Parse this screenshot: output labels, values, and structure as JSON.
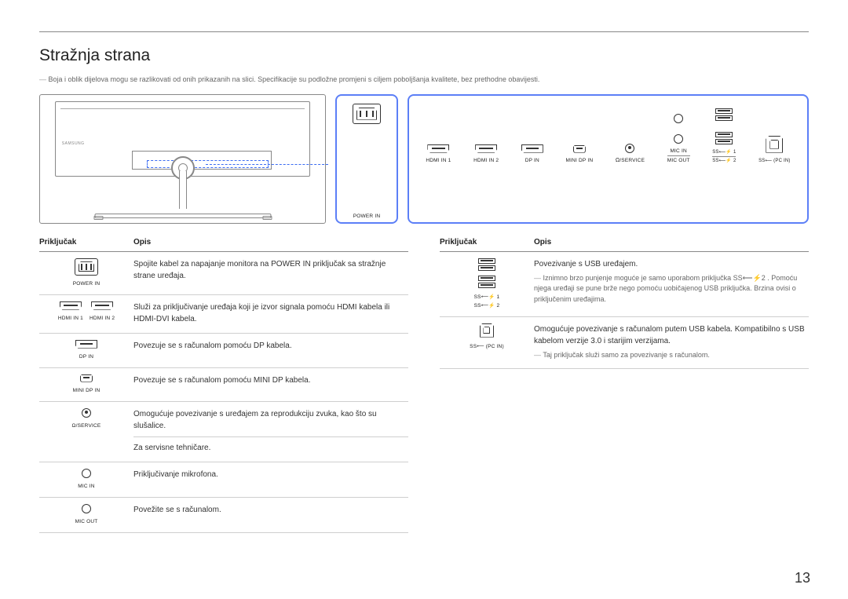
{
  "section_title": "Stražnja strana",
  "top_note": "Boja i oblik dijelova mogu se razlikovati od onih prikazanih na slici. Specifikacije su podložne promjeni s ciljem poboljšanja kvalitete, bez prethodne obavijesti.",
  "ports_panel": {
    "power_label": "POWER IN",
    "hdmi1": "HDMI IN 1",
    "hdmi2": "HDMI IN 2",
    "dp": "DP IN",
    "minidp": "MINI DP IN",
    "service": "/SERVICE",
    "mic_in": "MIC IN",
    "mic_out": "MIC OUT",
    "usb_ss1": "SS⟵⚡ 1",
    "usb_ss2": "SS⟵⚡ 2",
    "usb_pc": "SS⟵ (PC IN)"
  },
  "table_headers": {
    "col1": "Priključak",
    "col2": "Opis"
  },
  "left_table": [
    {
      "port_label": "POWER IN",
      "desc": "Spojite kabel za napajanje monitora na POWER IN priključak sa stražnje strane uređaja."
    },
    {
      "port_label": "HDMI IN 1",
      "port_label2": "HDMI IN 2",
      "desc": "Služi za priključivanje uređaja koji je izvor signala pomoću HDMI kabela ili HDMI-DVI kabela."
    },
    {
      "port_label": "DP IN",
      "desc": "Povezuje se s računalom pomoću DP kabela."
    },
    {
      "port_label": "MINI DP IN",
      "desc": "Povezuje se s računalom pomoću MINI DP kabela."
    },
    {
      "port_label": "Ω/SERVICE",
      "desc": "Omogućuje povezivanje s uređajem za reprodukciju zvuka, kao što su slušalice.",
      "desc2": "Za servisne tehničare."
    },
    {
      "port_label": "MIC IN",
      "desc": "Priključivanje mikrofona."
    },
    {
      "port_label": "MIC OUT",
      "desc": "Povežite se s računalom."
    }
  ],
  "right_table": [
    {
      "port_label1": "SS⟵⚡ 1",
      "port_label2": "SS⟵⚡ 2",
      "desc": "Povezivanje s USB uređajem.",
      "note": "Iznimno brzo punjenje moguće je samo uporabom priključka SS⟵⚡2 . Pomoću njega uređaji se pune brže nego pomoću uobičajenog USB priključka. Brzina ovisi o priključenim uređajima."
    },
    {
      "port_label": "SS⟵ (PC IN)",
      "desc": "Omogućuje povezivanje s računalom putem USB kabela. Kompatibilno s USB kabelom verzije 3.0 i starijim verzijama.",
      "note": "Taj priključak služi samo za povezivanje s računalom."
    }
  ],
  "page_number": "13"
}
